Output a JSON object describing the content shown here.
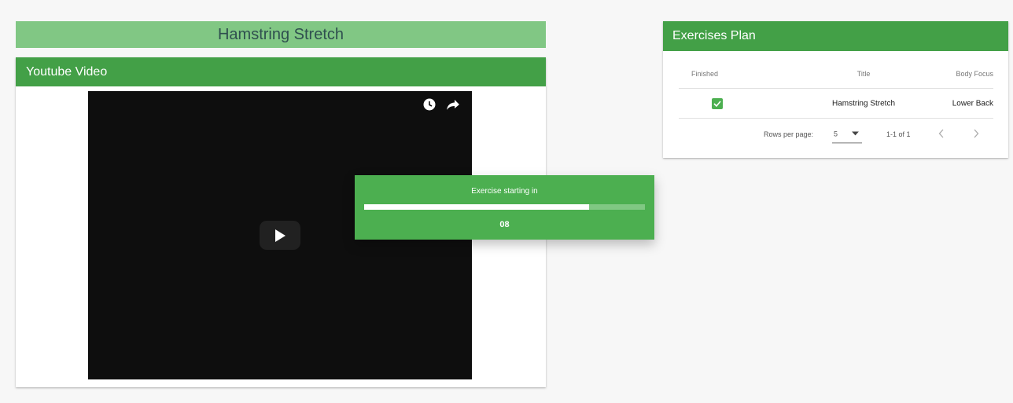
{
  "page_title": "Hamstring Stretch",
  "video_section": {
    "header": "Youtube Video"
  },
  "plan": {
    "header": "Exercises Plan",
    "columns": [
      "Finished",
      "Title",
      "Body Focus"
    ],
    "rows": [
      {
        "finished": true,
        "title": "Hamstring Stretch",
        "body_focus": "Lower Back"
      }
    ],
    "pagination": {
      "rows_per_page_label": "Rows per page:",
      "rows_per_page_value": "5",
      "range": "1-1 of 1"
    }
  },
  "countdown": {
    "label": "Exercise starting in",
    "value": "08",
    "progress": 0.8
  },
  "colors": {
    "primary": "#43a047",
    "light": "#81c784",
    "overlay": "#4caf50"
  },
  "icons": [
    "watch-later-icon",
    "share-icon",
    "play-icon",
    "checkbox-checked-icon",
    "dropdown-arrow-icon",
    "chevron-left-icon",
    "chevron-right-icon"
  ]
}
